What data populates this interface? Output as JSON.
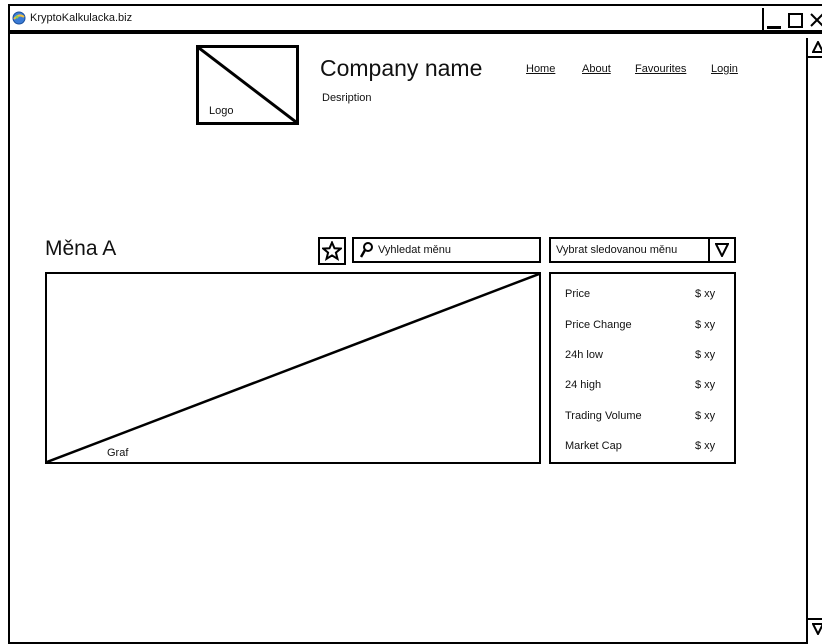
{
  "window": {
    "title": "KryptoKalkulacka.biz",
    "controls": [
      "minimize-icon",
      "maximize-icon",
      "close-icon"
    ]
  },
  "header": {
    "logo_label": "Logo",
    "company_name": "Company name",
    "description": "Desription",
    "nav": [
      "Home",
      "About",
      "Favourites",
      "Login"
    ]
  },
  "toolbar": {
    "currency_title": "Měna A",
    "favourite_icon": "star-icon",
    "search_placeholder": "Vyhledat měnu",
    "watchlist_select": "Vybrat sledovanou měnu",
    "dropdown_icon": "triangle-down-icon"
  },
  "chart": {
    "label": "Graf"
  },
  "stats": [
    {
      "label": "Price",
      "value": "$ xy"
    },
    {
      "label": "Price Change",
      "value": "$ xy"
    },
    {
      "label": "24h low",
      "value": "$ xy"
    },
    {
      "label": "24 high",
      "value": "$ xy"
    },
    {
      "label": "Trading Volume",
      "value": "$ xy"
    },
    {
      "label": "Market Cap",
      "value": "$ xy"
    }
  ]
}
